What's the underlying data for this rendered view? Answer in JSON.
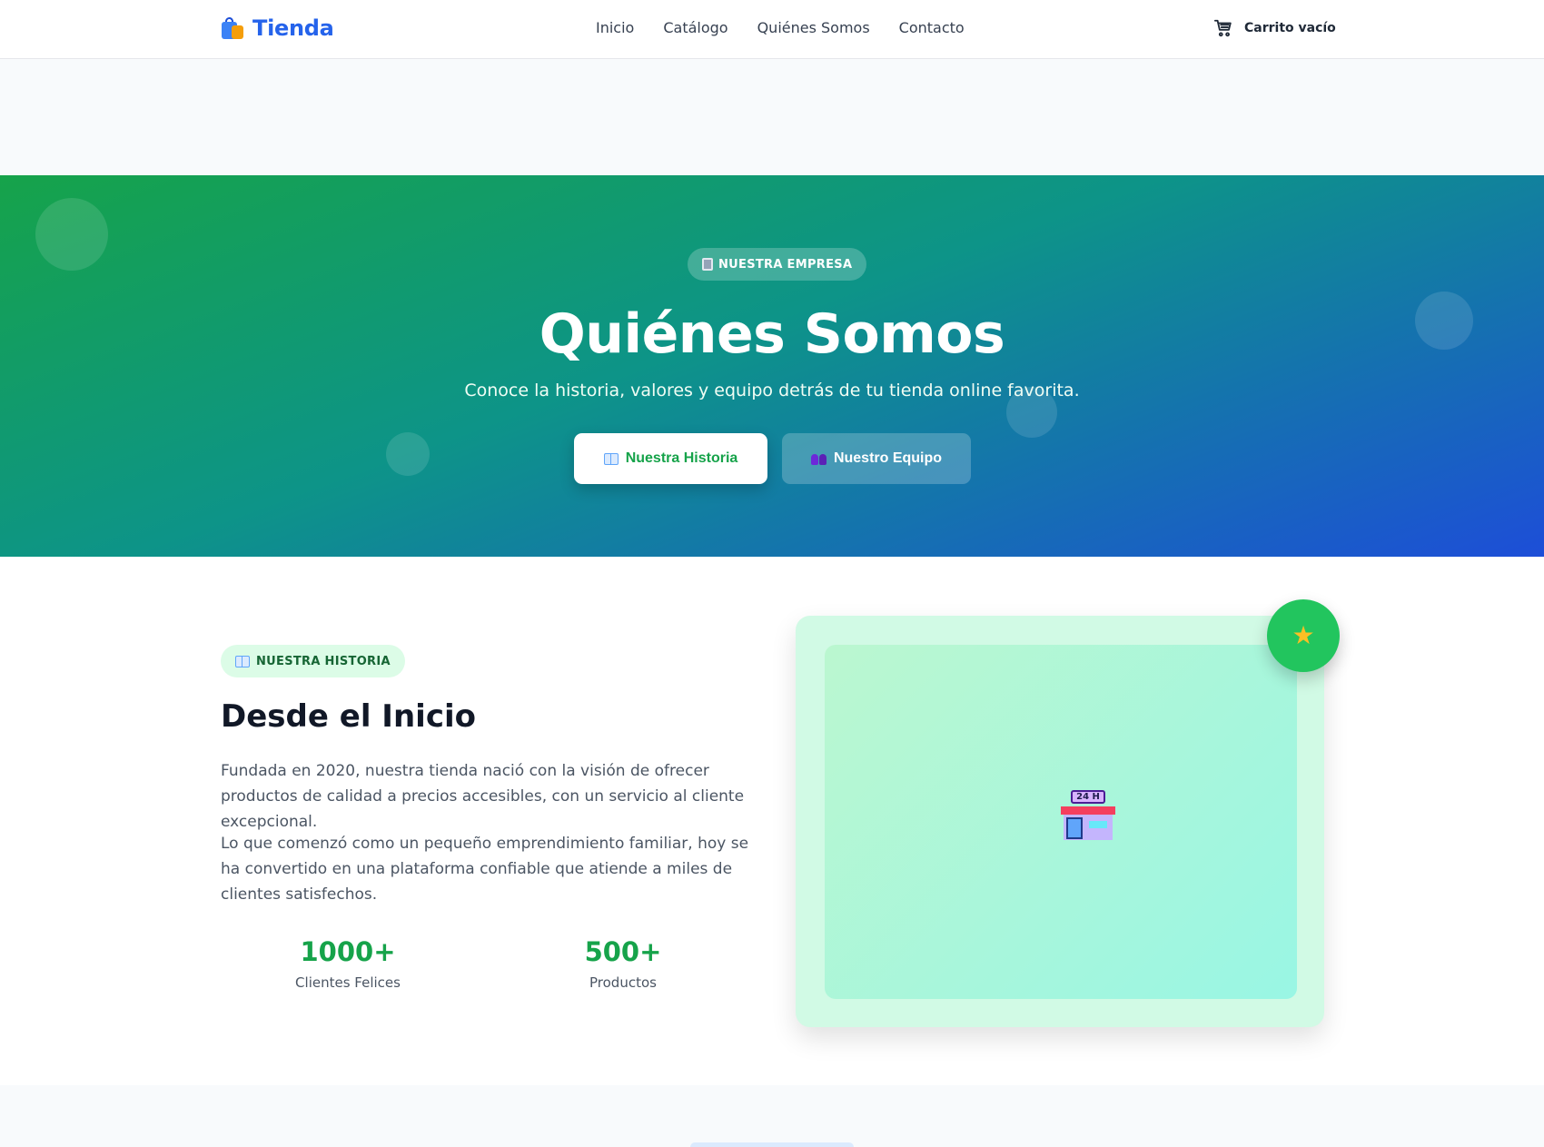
{
  "header": {
    "logo_text": "Tienda",
    "nav": [
      "Inicio",
      "Catálogo",
      "Quiénes Somos",
      "Contacto"
    ],
    "cart_label": "Carrito vacío"
  },
  "hero": {
    "badge": "NUESTRA EMPRESA",
    "title": "Quiénes Somos",
    "subtitle": "Conoce la historia, valores y equipo detrás de tu tienda online favorita.",
    "primary_button": "Nuestra Historia",
    "secondary_button": "Nuestro Equipo"
  },
  "history": {
    "badge": "NUESTRA HISTORIA",
    "title": "Desde el Inicio",
    "paragraph1": "Fundada en 2020, nuestra tienda nació con la visión de ofrecer productos de calidad a precios accesibles, con un servicio al cliente excepcional.",
    "paragraph2": "Lo que comenzó como un pequeño emprendimiento familiar, hoy se ha convertido en una plataforma confiable que atiende a miles de clientes satisfechos.",
    "stats": [
      {
        "value": "1000+",
        "label": "Clientes Felices"
      },
      {
        "value": "500+",
        "label": "Productos"
      }
    ],
    "store_sign": "24 H"
  },
  "colors": {
    "brand": "#2563eb",
    "accent_green": "#16a34a",
    "hero_gradient": [
      "#16a34a",
      "#0d9488",
      "#1d4ed8"
    ]
  },
  "icons": [
    "shopping-bags-icon",
    "cart-icon",
    "office-building-icon",
    "book-icon",
    "people-icon",
    "convenience-store-icon",
    "star-icon"
  ]
}
